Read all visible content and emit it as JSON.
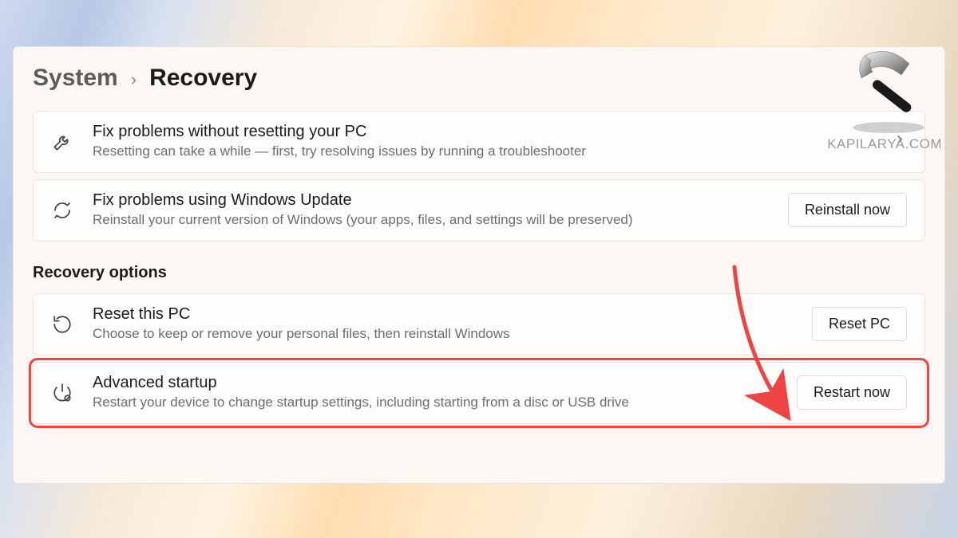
{
  "breadcrumb": {
    "parent": "System",
    "current": "Recovery"
  },
  "cards": {
    "troubleshoot": {
      "title": "Fix problems without resetting your PC",
      "desc": "Resetting can take a while — first, try resolving issues by running a troubleshooter"
    },
    "winupdate": {
      "title": "Fix problems using Windows Update",
      "desc": "Reinstall your current version of Windows (your apps, files, and settings will be preserved)",
      "button": "Reinstall now"
    }
  },
  "section": {
    "title": "Recovery options"
  },
  "options": {
    "reset": {
      "title": "Reset this PC",
      "desc": "Choose to keep or remove your personal files, then reinstall Windows",
      "button": "Reset PC"
    },
    "advanced": {
      "title": "Advanced startup",
      "desc": "Restart your device to change startup settings, including starting from a disc or USB drive",
      "button": "Restart now"
    }
  },
  "watermark": {
    "text": "KAPILARYA.COM"
  }
}
